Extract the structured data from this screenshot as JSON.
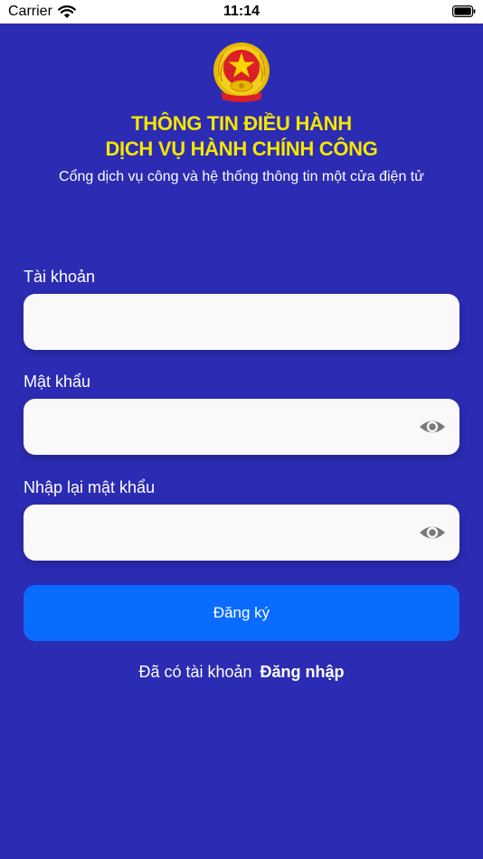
{
  "status_bar": {
    "carrier": "Carrier",
    "time": "11:14",
    "icons": [
      "wifi-icon",
      "battery-icon"
    ]
  },
  "header": {
    "emblem_icon": "national-emblem-icon",
    "title_line1": "THÔNG TIN ĐIỀU HÀNH",
    "title_line2": "DỊCH VỤ HÀNH CHÍNH CÔNG",
    "subtitle": "Cổng dịch vụ công và hệ thống thông tin một cửa điện tử"
  },
  "form": {
    "username": {
      "label": "Tài khoản",
      "value": "",
      "placeholder": ""
    },
    "password": {
      "label": "Mật khẩu",
      "value": "",
      "placeholder": "",
      "toggle_icon": "eye-icon"
    },
    "confirm_password": {
      "label": "Nhập lại mật khẩu",
      "value": "",
      "placeholder": "",
      "toggle_icon": "eye-icon"
    },
    "submit_label": "Đăng ký"
  },
  "footer": {
    "prompt": "Đã có tài khoản",
    "login_link": "Đăng nhập"
  },
  "colors": {
    "background": "#2b2bb3",
    "title": "#f5e600",
    "button": "#0a6cff",
    "input_bg": "#f9f9f9"
  }
}
